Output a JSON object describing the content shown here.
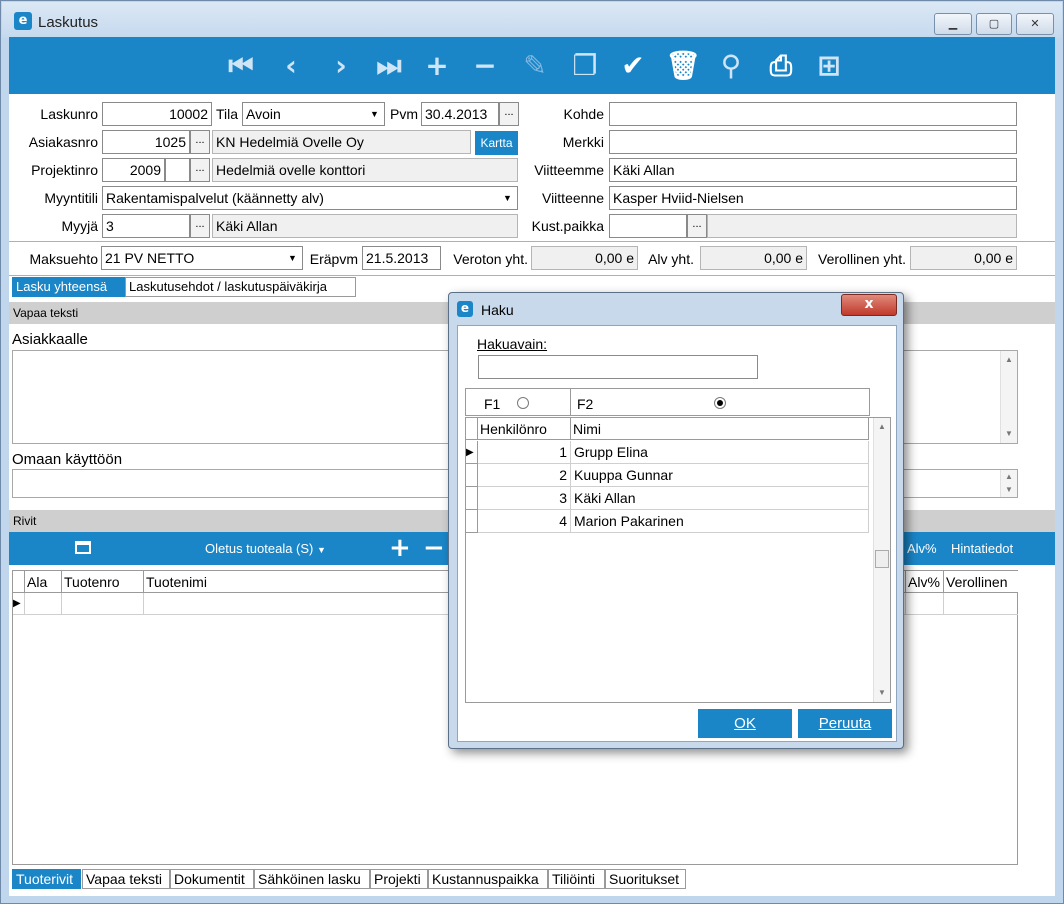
{
  "window": {
    "title": "Laskutus",
    "minimize_icon": "minimize-icon",
    "maximize_icon": "maximize-icon",
    "close_icon": "close-icon"
  },
  "toolbar": {
    "first_icon": "first-record-icon",
    "prev_icon": "previous-record-icon",
    "next_icon": "next-record-icon",
    "last_icon": "last-record-icon",
    "add_icon": "add-icon",
    "remove_icon": "remove-icon",
    "edit_icon": "edit-icon",
    "copy_icon": "copy-icon",
    "save_icon": "checkmark-icon",
    "delete_icon": "trash-icon",
    "flashlight_icon": "flashlight-icon",
    "print_icon": "printer-icon",
    "export_icon": "export-icon"
  },
  "form": {
    "laskunro_label": "Laskunro",
    "laskunro_value": "10002",
    "tila_label": "Tila",
    "tila_value": "Avoin",
    "pvm_label": "Pvm",
    "pvm_value": "30.4.2013",
    "kohde_label": "Kohde",
    "kohde_value": "",
    "asiakasnro_label": "Asiakasnro",
    "asiakasnro_value": "1025",
    "asiakas_name": "KN Hedelmiä Ovelle Oy",
    "kartta_label": "Kartta",
    "merkki_label": "Merkki",
    "merkki_value": "",
    "projektinro_label": "Projektinro",
    "projektinro_value": "2009",
    "projekti_name": "Hedelmiä ovelle konttori",
    "viitteemme_label": "Viitteemme",
    "viitteemme_value": "Käki Allan",
    "myyntitili_label": "Myyntitili",
    "myyntitili_value": "Rakentamispalvelut (käännetty alv)",
    "viitteenne_label": "Viitteenne",
    "viitteenne_value": "Kasper Hviid-Nielsen",
    "myyja_label": "Myyjä",
    "myyja_value": "3",
    "myyja_name": "Käki Allan",
    "kustpaikka_label": "Kust.paikka",
    "kustpaikka_value": "",
    "maksuehto_label": "Maksuehto",
    "maksuehto_value": "21 PV NETTO",
    "erapvm_label": "Eräpvm",
    "erapvm_value": "21.5.2013",
    "veroton_label": "Veroton yht.",
    "veroton_value": "0,00 e",
    "alv_label": "Alv yht.",
    "alv_value": "0,00 e",
    "verollinen_label": "Verollinen yht.",
    "verollinen_value": "0,00 e",
    "ellipsis": "..."
  },
  "tabs": [
    "Lasku yhteensä",
    "Laskutusehdot / laskutuspäiväkirja"
  ],
  "vapaa_teksti": {
    "band": "Vapaa teksti",
    "asiakkaalle_label": "Asiakkaalle",
    "omaan_label": "Omaan käyttöön"
  },
  "rivit": {
    "band": "Rivit",
    "tuoteala": "Oletus tuoteala (S)",
    "alv_pct": "Alv%",
    "hintatiedot": "Hintatiedot",
    "columns": {
      "ala": "Ala",
      "tuotenro": "Tuotenro",
      "tuotenimi": "Tuotenimi",
      "alv": "Alv%",
      "verollinen": "Verollinen"
    }
  },
  "bottom_tabs": [
    "Tuoterivit",
    "Vapaa teksti",
    "Dokumentit",
    "Sähköinen lasku",
    "Projekti",
    "Kustannuspaikka",
    "Tiliöinti",
    "Suoritukset"
  ],
  "dialog": {
    "title": "Haku",
    "close_label": "x",
    "hakuavain_label": "Hakuavain:",
    "hakuavain_value": "",
    "f1_label": "F1",
    "f2_label": "F2",
    "col_henkilonro": "Henkilönro",
    "col_nimi": "Nimi",
    "rows": [
      {
        "nro": "1",
        "nimi": "Grupp Elina"
      },
      {
        "nro": "2",
        "nimi": "Kuuppa Gunnar"
      },
      {
        "nro": "3",
        "nimi": "Käki Allan"
      },
      {
        "nro": "4",
        "nimi": "Marion Pakarinen"
      }
    ],
    "ok_label": "OK",
    "cancel_label": "Peruuta"
  }
}
